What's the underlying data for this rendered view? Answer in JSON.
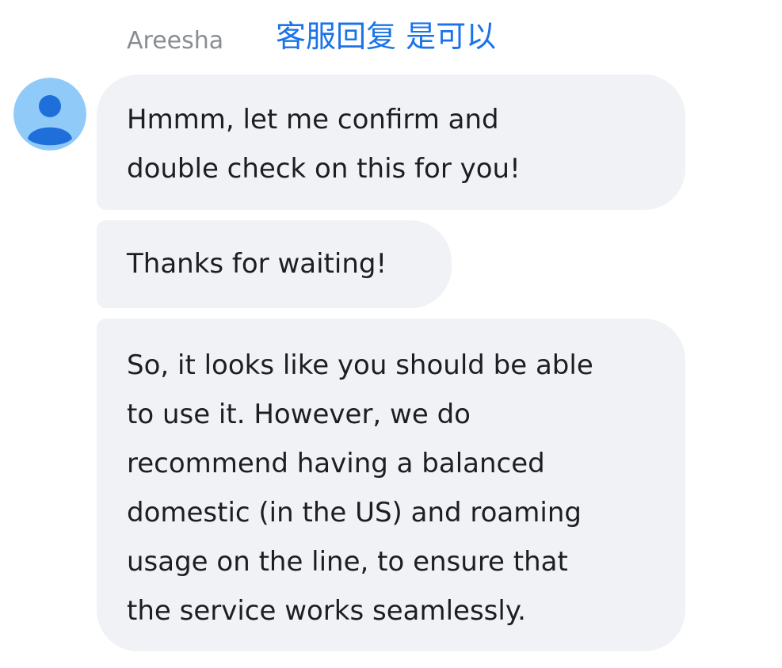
{
  "sender": {
    "name": "Areesha"
  },
  "annotation": {
    "text": "客服回复 是可以",
    "color": "#1a73e8"
  },
  "avatar": {
    "icon": "user-silhouette-icon",
    "background": "#90caf9",
    "figure_color": "#1e6fd9"
  },
  "messages": [
    {
      "lines": [
        "Hmmm, let me confirm and",
        "double check on this for you!"
      ]
    },
    {
      "lines": [
        "Thanks for waiting!"
      ]
    },
    {
      "lines": [
        "So, it looks like you should be able",
        "to use it. However, we do",
        "recommend having a balanced",
        "domestic (in the US) and roaming",
        "usage on the line, to ensure that",
        "the service works seamlessly."
      ]
    }
  ],
  "colors": {
    "bubble_background": "#f0f2f5",
    "text": "#1c1e21",
    "sender_name": "#8a8d91"
  }
}
